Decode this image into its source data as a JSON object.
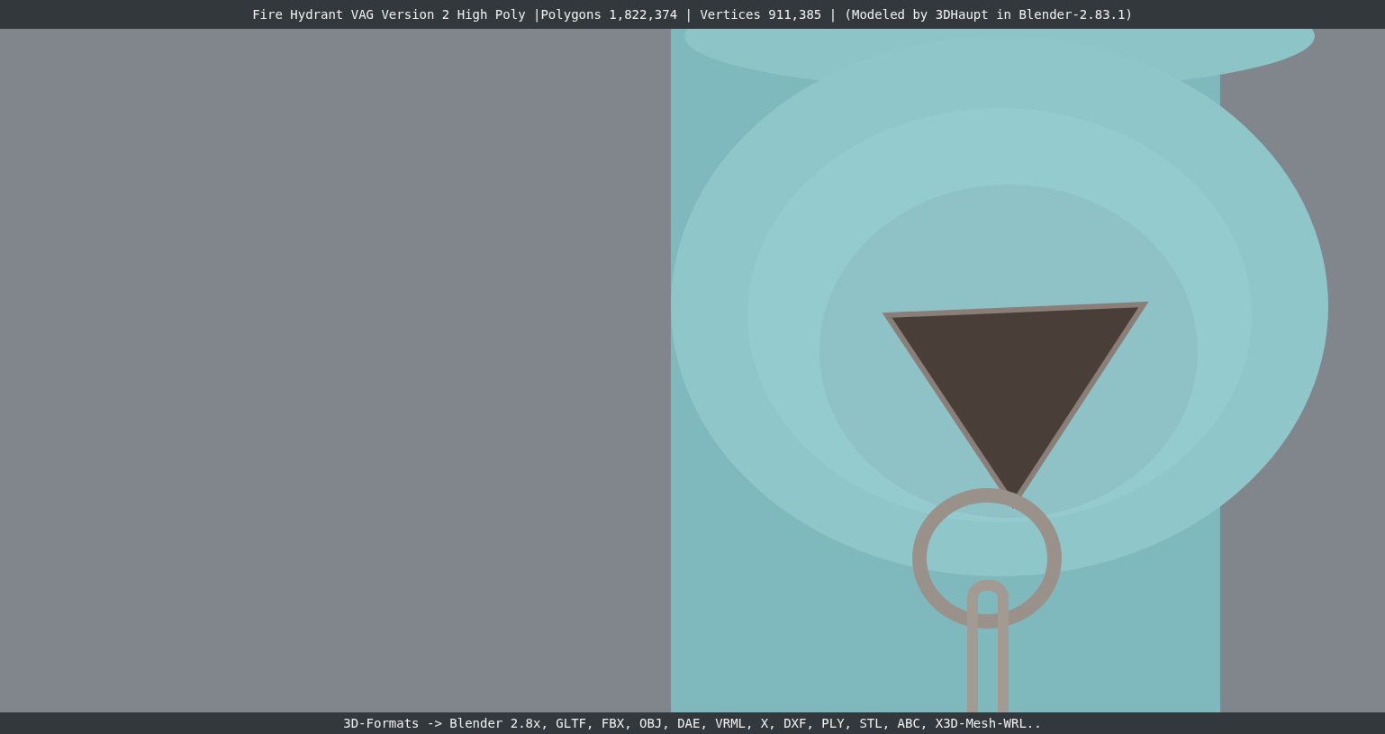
{
  "top_bar": {
    "text": "Fire Hydrant VAG Version 2 High Poly |Polygons 1,822,374 | Vertices 911,385 | (Modeled by 3DHaupt in Blender-2.83.1)"
  },
  "bottom_bar": {
    "text": "3D-Formats -> Blender 2.8x, GLTF, FBX, OBJ, DAE, VRML, X, DXF, PLY, STL, ABC, X3D-Mesh-WRL.."
  }
}
